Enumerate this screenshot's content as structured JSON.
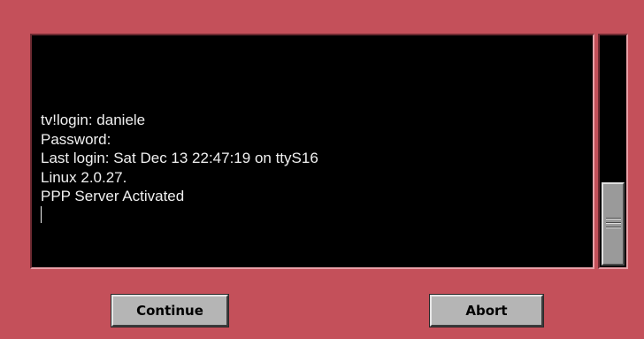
{
  "terminal": {
    "lines": [
      "tv!login: daniele",
      "Password:",
      "Last login: Sat Dec 13 22:47:19 on ttyS16",
      "Linux 2.0.27.",
      "PPP Server Activated"
    ]
  },
  "buttons": {
    "continue_label": "Continue",
    "abort_label": "Abort"
  },
  "colors": {
    "background": "#c4505a",
    "terminal_background": "#000000",
    "terminal_text": "#f0f0f0",
    "button_face": "#b5b5b5"
  },
  "icons": {
    "scroll_thumb_grip": "grip-lines-icon"
  }
}
